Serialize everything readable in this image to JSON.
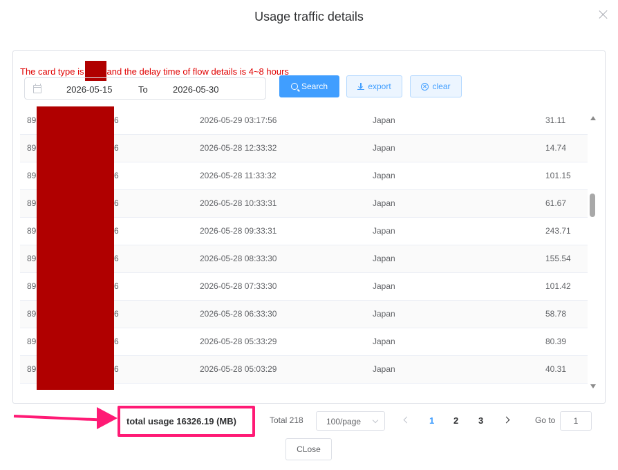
{
  "dialog": {
    "title": "Usage traffic details"
  },
  "notice": {
    "prefix": "The card type is",
    "suffix": "and the delay time of flow details is 4~8 hours"
  },
  "filter": {
    "start_date": "2026-05-15",
    "separator": "To",
    "end_date": "2026-05-30",
    "search_label": "Search",
    "export_label": "export",
    "clear_label": "clear"
  },
  "rows": [
    {
      "id_head": "89",
      "id_tail": "6",
      "time": "2026-05-29 03:17:56",
      "country": "Japan",
      "usage": "31.11"
    },
    {
      "id_head": "89",
      "id_tail": "6",
      "time": "2026-05-28 12:33:32",
      "country": "Japan",
      "usage": "14.74"
    },
    {
      "id_head": "89",
      "id_tail": "6",
      "time": "2026-05-28 11:33:32",
      "country": "Japan",
      "usage": "101.15"
    },
    {
      "id_head": "89",
      "id_tail": "6",
      "time": "2026-05-28 10:33:31",
      "country": "Japan",
      "usage": "61.67"
    },
    {
      "id_head": "89",
      "id_tail": "6",
      "time": "2026-05-28 09:33:31",
      "country": "Japan",
      "usage": "243.71"
    },
    {
      "id_head": "89",
      "id_tail": "6",
      "time": "2026-05-28 08:33:30",
      "country": "Japan",
      "usage": "155.54"
    },
    {
      "id_head": "89",
      "id_tail": "6",
      "time": "2026-05-28 07:33:30",
      "country": "Japan",
      "usage": "101.42"
    },
    {
      "id_head": "89",
      "id_tail": "6",
      "time": "2026-05-28 06:33:30",
      "country": "Japan",
      "usage": "58.78"
    },
    {
      "id_head": "89",
      "id_tail": "6",
      "time": "2026-05-28 05:33:29",
      "country": "Japan",
      "usage": "80.39"
    },
    {
      "id_head": "89",
      "id_tail": "6",
      "time": "2026-05-28 05:03:29",
      "country": "Japan",
      "usage": "40.31"
    }
  ],
  "summary": {
    "total_usage": "total usage 16326.19 (MB)"
  },
  "pagination": {
    "total": "Total 218",
    "page_size": "100/page",
    "pages": [
      "1",
      "2",
      "3"
    ],
    "current_page": "1",
    "goto_label": "Go to",
    "goto_value": "1"
  },
  "footer": {
    "close_label": "CLose"
  },
  "colors": {
    "accent": "#409eff",
    "notice": "#e00000",
    "redaction": "#b00000",
    "annotation": "#ff1a75"
  }
}
